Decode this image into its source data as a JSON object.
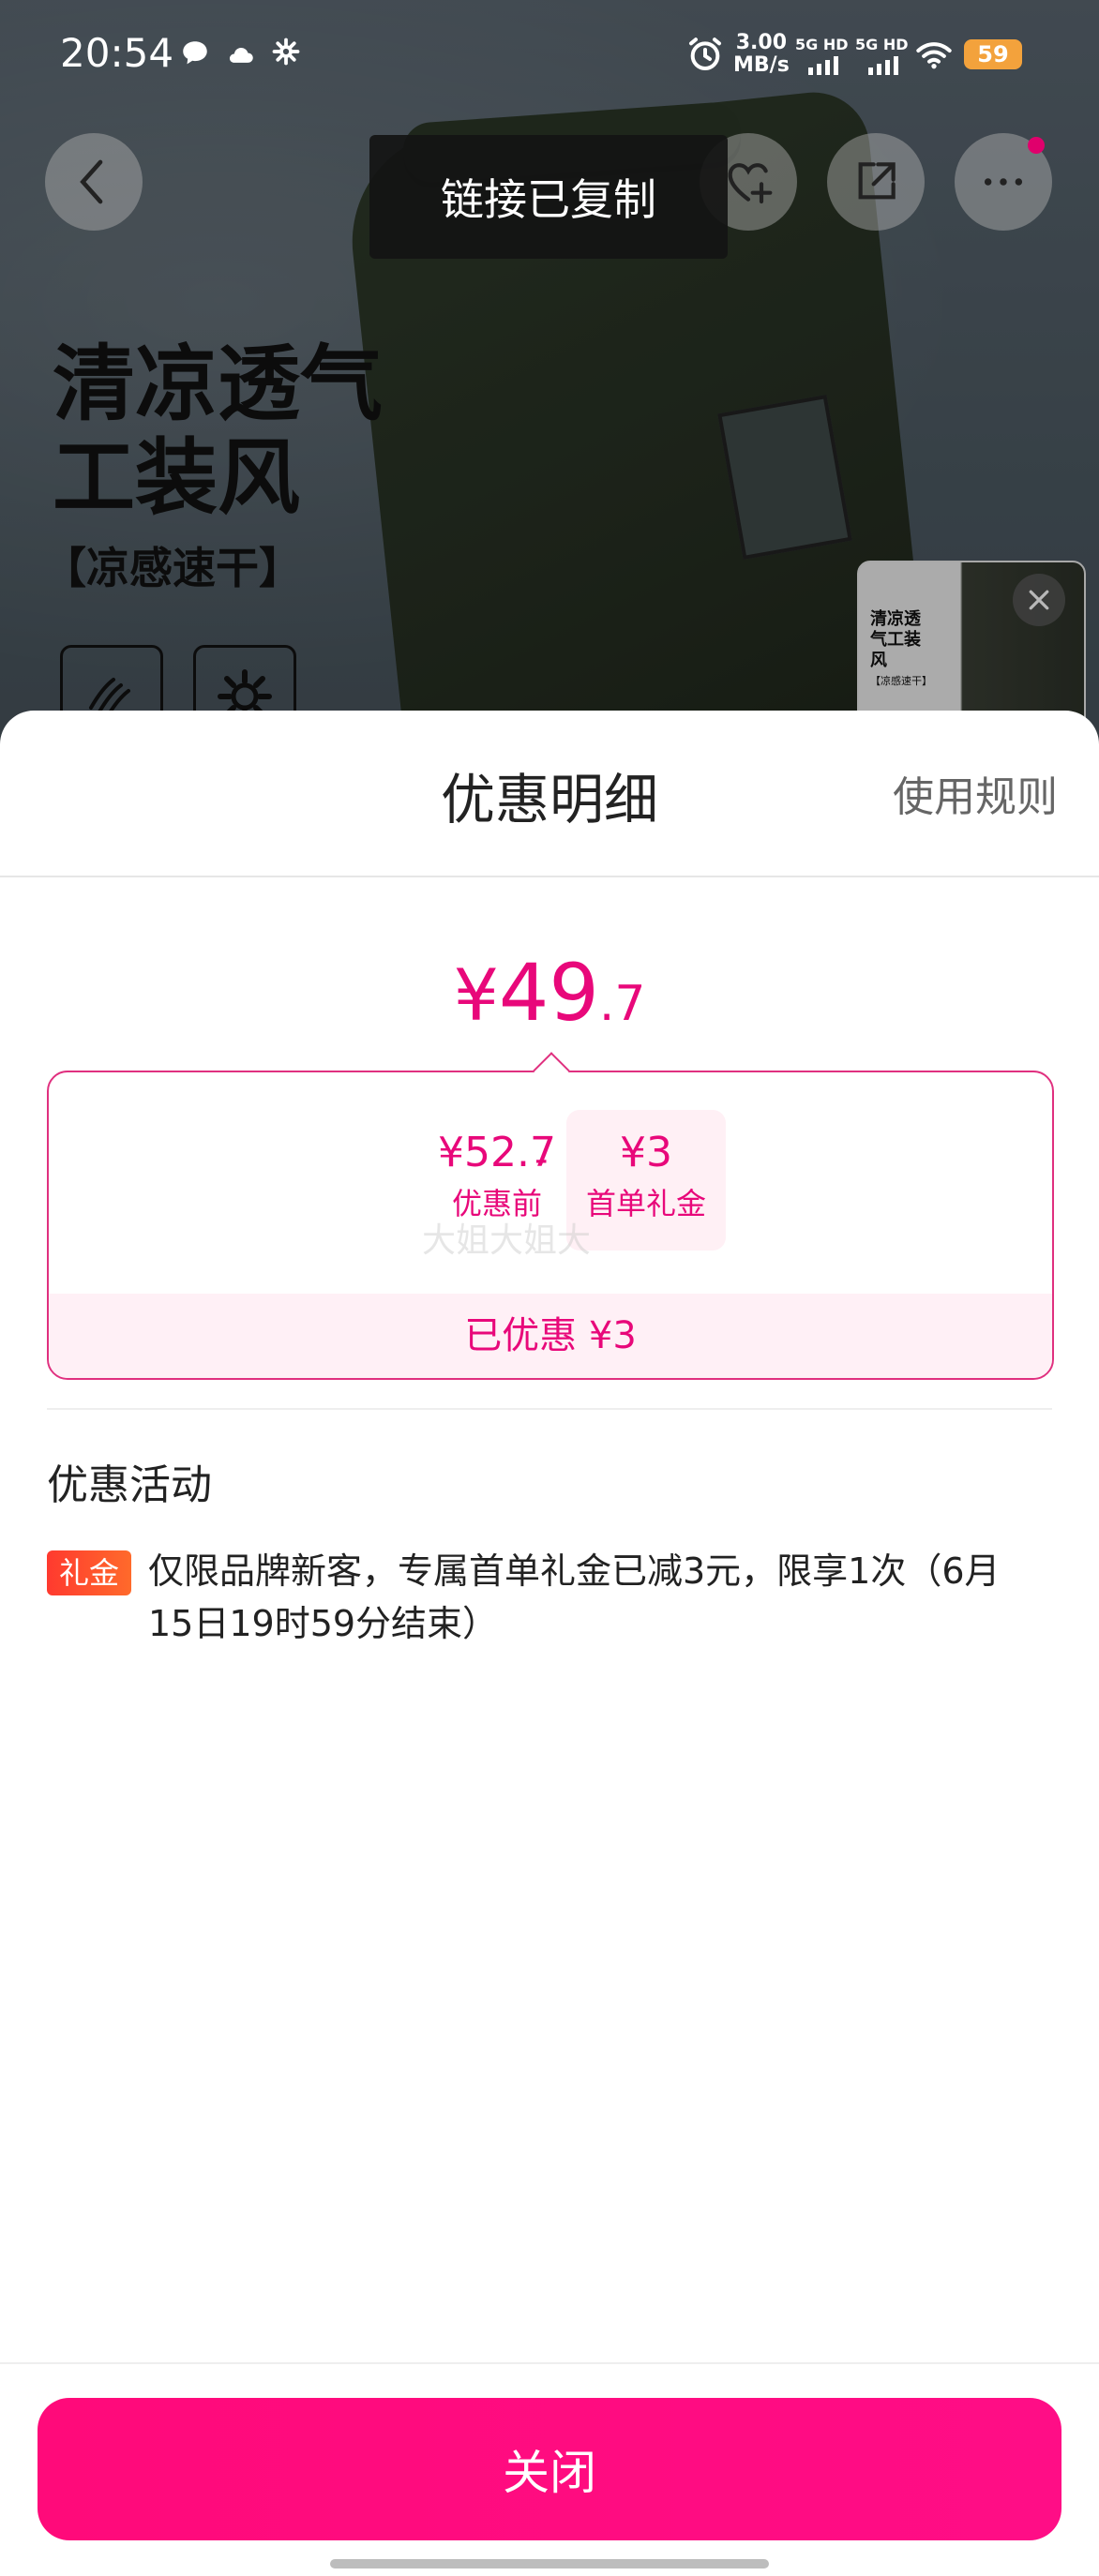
{
  "status_bar": {
    "time": "20:54",
    "net_speed_value": "3.00",
    "net_speed_unit": "MB/s",
    "signal1_label": "5G HD",
    "signal2_label": "5G HD",
    "battery": "59"
  },
  "toast": {
    "text": "链接已复制"
  },
  "product": {
    "headline": "清凉透气工装风",
    "subheadline": "【凉感速干】",
    "thumbnail_text": "清凉透气工装风",
    "thumbnail_subtext": "【凉感速干】"
  },
  "sheet": {
    "title": "优惠明细",
    "rules_link": "使用规则",
    "final_price": {
      "yen": "¥",
      "integer": "49",
      "decimal": ".7"
    },
    "original": {
      "value": "¥52.7",
      "label": "优惠前"
    },
    "minus": "-",
    "gift": {
      "value": "¥3",
      "label": "首单礼金"
    },
    "watermark": "大姐大姐大",
    "saved": "已优惠 ¥3",
    "promo_heading": "优惠活动",
    "promo_tag": "礼金",
    "promo_text": "仅限品牌新客，专属首单礼金已减3元，限享1次（6月15日19时59分结束）",
    "close_button": "关闭"
  },
  "colors": {
    "accent": "#e8087a",
    "button": "#ff0a7a",
    "tag": "#ff3a2f"
  }
}
